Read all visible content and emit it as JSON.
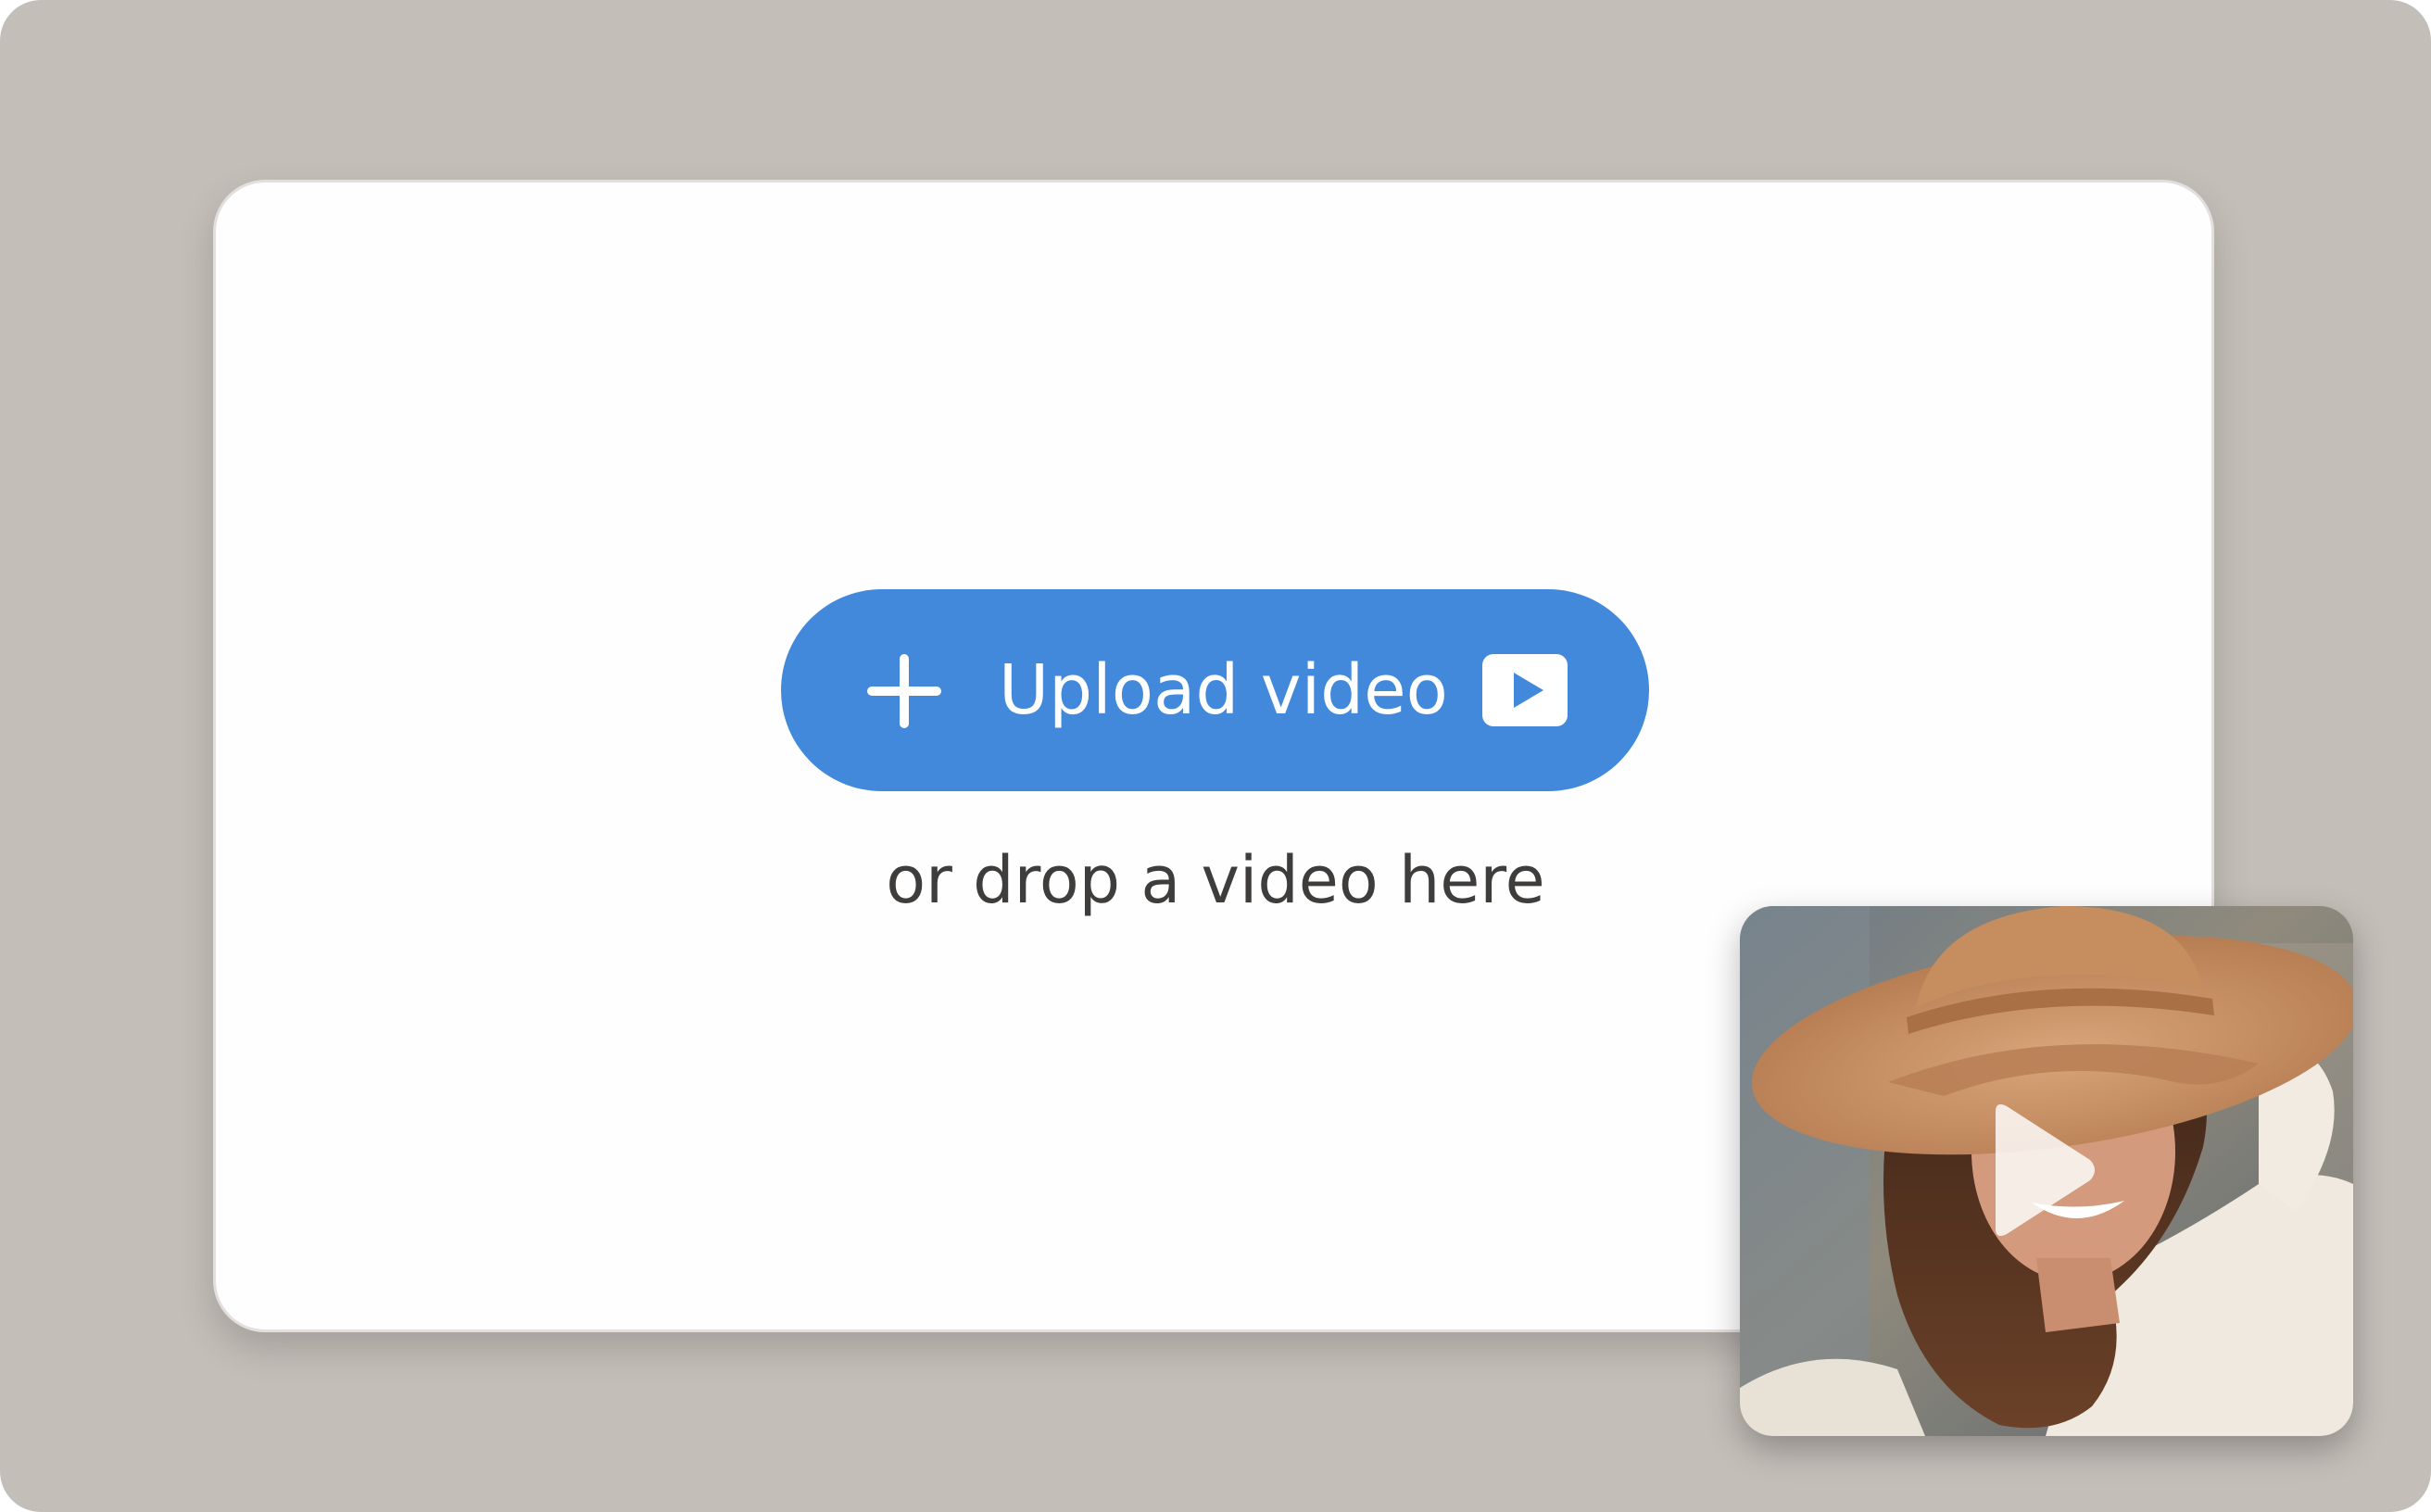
{
  "upload": {
    "button_label": "Upload video",
    "drop_hint": "or drop a video here"
  },
  "colors": {
    "background": "#c4beb8",
    "card": "#fefefe",
    "accent": "#4289dc",
    "hint_text": "#3f3d3b"
  },
  "icons": {
    "add": "plus-icon",
    "video": "video-play-icon",
    "thumbnail_play": "play-icon"
  },
  "preview": {
    "description_icon": "video-thumbnail"
  }
}
